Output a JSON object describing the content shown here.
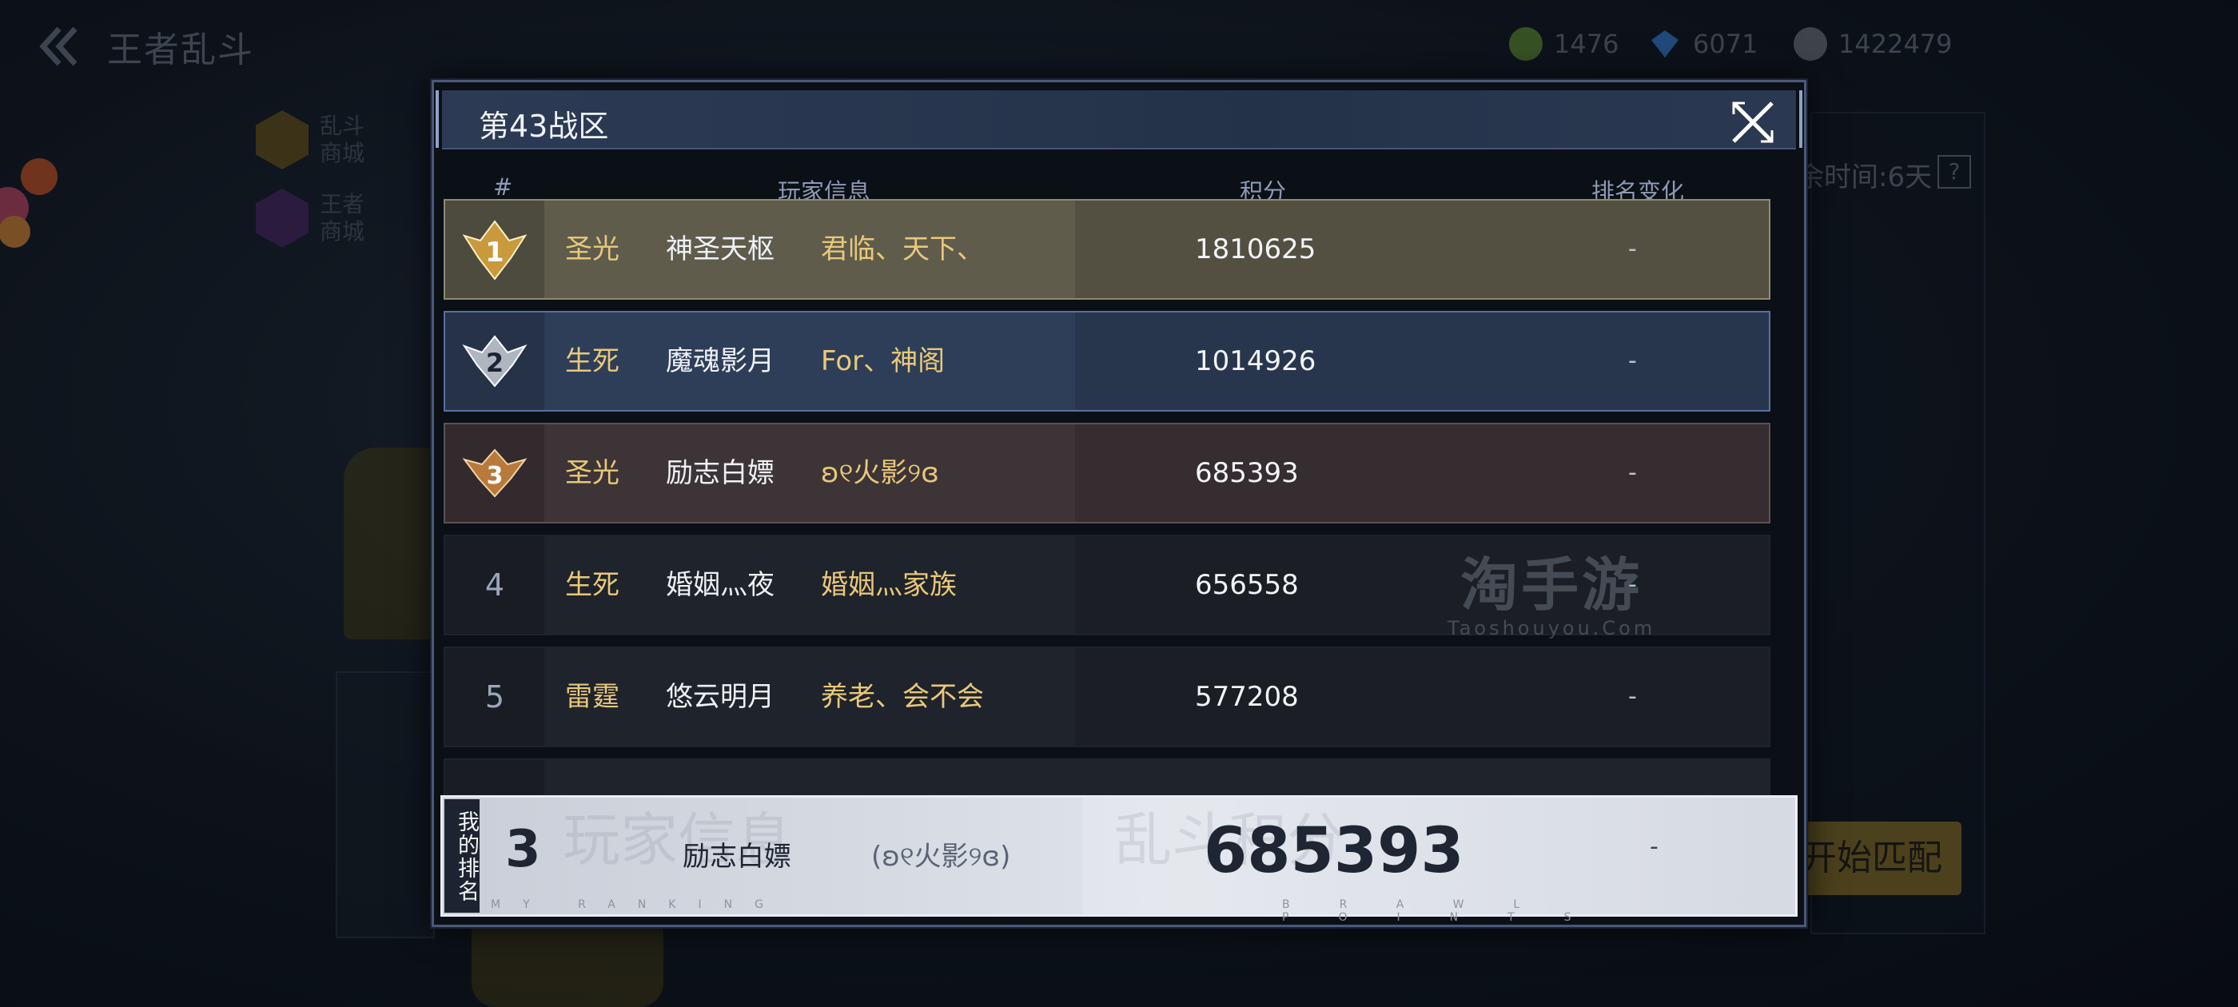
{
  "topbar": {
    "title": "王者乱斗",
    "currencies": [
      {
        "icon": "green-token-icon",
        "value": "1476",
        "color": "#5f8f3a"
      },
      {
        "icon": "diamond-icon",
        "value": "6071",
        "color": "#3b7fd6"
      },
      {
        "icon": "coin-icon",
        "value": "1422479",
        "color": "#6e7480"
      }
    ]
  },
  "side_menu": [
    {
      "label": "乱斗\n商城",
      "icon": "brawl-shop-icon",
      "color": "#6b5520"
    },
    {
      "label": "王者\n商城",
      "icon": "king-shop-icon",
      "color": "#4a2a68"
    }
  ],
  "background": {
    "timer_text": "余时间:6天",
    "help_label": "?",
    "match_button": "开始匹配"
  },
  "modal": {
    "title": "第43战区",
    "close_icon": "close-icon",
    "columns": {
      "rank": "#",
      "player": "玩家信息",
      "score": "积分",
      "change": "排名变化"
    },
    "rows": [
      {
        "rank": "1",
        "medal": "gold-medal-icon",
        "server": "圣光",
        "name": "神圣天枢",
        "guild": "君临、天下、",
        "score": "1810625",
        "change": "-"
      },
      {
        "rank": "2",
        "medal": "silver-medal-icon",
        "server": "生死",
        "name": "魔魂影月",
        "guild": "For、神阁",
        "score": "1014926",
        "change": "-"
      },
      {
        "rank": "3",
        "medal": "bronze-medal-icon",
        "server": "圣光",
        "name": "励志白嫖",
        "guild": "ʚ୧火影୨ɞ",
        "score": "685393",
        "change": "-"
      },
      {
        "rank": "4",
        "medal": "",
        "server": "生死",
        "name": "婚姻灬夜",
        "guild": "婚姻灬家族",
        "score": "656558",
        "change": "-"
      },
      {
        "rank": "5",
        "medal": "",
        "server": "雷霆",
        "name": "悠云明月",
        "guild": "养老、会不会",
        "score": "577208",
        "change": "-"
      }
    ],
    "watermark": {
      "main": "淘手游",
      "sub": "Taoshouyou.Com"
    },
    "my_ranking": {
      "tag": "我的排名",
      "position": "3",
      "name": "励志白嫖",
      "guild": "(ʚ୧火影୨ɞ)",
      "score": "685393",
      "change": "-",
      "ghost_left": "玩家信息",
      "ghost_right": "乱斗积分",
      "sub_left": "MY RANKING",
      "sub_right": "BRAWL POINTS"
    }
  }
}
